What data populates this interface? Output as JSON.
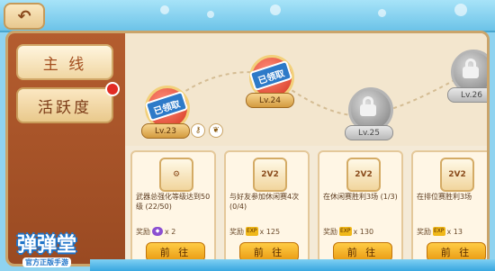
{
  "header": {
    "back_icon": "back-arrow-icon"
  },
  "sidebar": {
    "tabs": [
      {
        "label": "主 线",
        "active": true
      },
      {
        "label": "活跃度",
        "active": false,
        "has_red_dot": true
      }
    ]
  },
  "levels": [
    {
      "label": "Lv.23",
      "status": "claimed",
      "stamp": "已领取"
    },
    {
      "label": "Lv.24",
      "status": "claimed",
      "stamp": "已领取"
    },
    {
      "label": "Lv.25",
      "status": "locked"
    },
    {
      "label": "Lv.26",
      "status": "locked"
    }
  ],
  "tasks": [
    {
      "icon_text": "",
      "icon": "weapon-icon",
      "title": "武器总强化等级达到50级 (22/50)",
      "reward_label": "奖励",
      "reward_icon": "gem-icon",
      "reward_value": "x 2",
      "button": "前 往"
    },
    {
      "icon_text": "2V2",
      "icon": "2v2-icon",
      "title": "与好友参加休闲赛4次 (0/4)",
      "reward_label": "奖励",
      "reward_icon": "exp-icon",
      "reward_icon_text": "EXP",
      "reward_value": "x 125",
      "button": "前 往"
    },
    {
      "icon_text": "2V2",
      "icon": "2v2-icon",
      "title": "在休闲赛胜利3场 (1/3)",
      "reward_label": "奖励",
      "reward_icon": "exp-icon",
      "reward_icon_text": "EXP",
      "reward_value": "x 130",
      "button": "前 往"
    },
    {
      "icon_text": "2V2",
      "icon": "2v2-icon",
      "title": "在排位赛胜利3场",
      "reward_label": "奖励",
      "reward_icon": "exp-icon",
      "reward_icon_text": "EXP",
      "reward_value": "x 13",
      "button": "前 往"
    }
  ],
  "logo": {
    "title": "弹弹堂",
    "subtitle": "官方正版手游"
  },
  "colors": {
    "accent": "#e99a12",
    "panel": "#f4ead7",
    "sidebar": "#b45d2f"
  }
}
